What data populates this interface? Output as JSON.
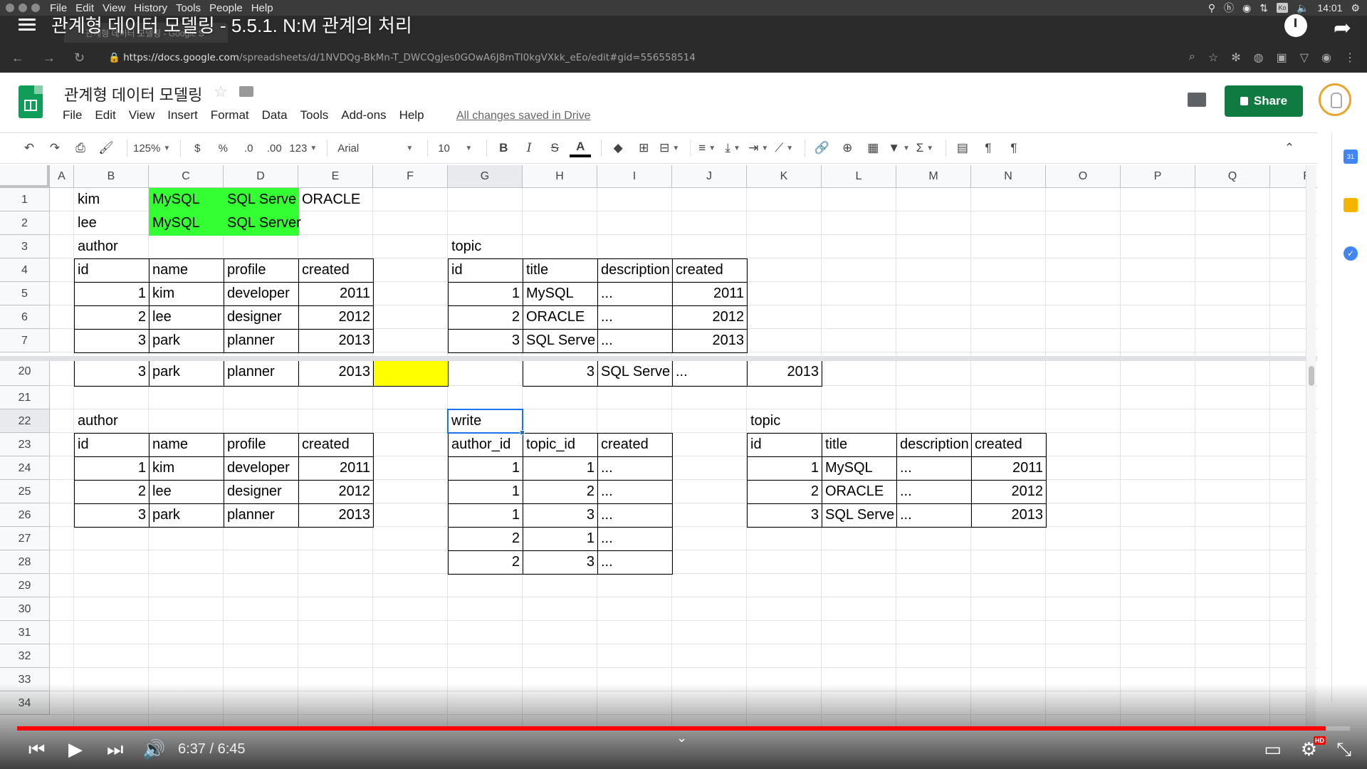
{
  "os_bar": {
    "menu": [
      "File",
      "Edit",
      "View",
      "History",
      "Tools",
      "People",
      "Help"
    ],
    "clock": "14:01",
    "kb": "Ko"
  },
  "video": {
    "title": "관계형 데이터 모델링 - 5.5.1. N:M 관계의 처리",
    "time": "6:37 / 6:45",
    "progress": 0.982,
    "hd": "HD"
  },
  "browser": {
    "tab_title": "관계형 데이터 모델링 - Google S",
    "url_host": "https://docs.google.com",
    "url_path": "/spreadsheets/d/1NVDQg-BkMn-T_DWCQgJes0GOwA6J8mTI0kgVXkk_eEo/edit#gid=556558514"
  },
  "sheets": {
    "title": "관계형 데이터 모델링",
    "menu": [
      "File",
      "Edit",
      "View",
      "Insert",
      "Format",
      "Data",
      "Tools",
      "Add-ons",
      "Help"
    ],
    "saved_status": "All changes saved in Drive",
    "share_label": "Share",
    "toolbar": {
      "zoom": "125%",
      "currency": "$",
      "percent": "%",
      "dec_less": ".0",
      "dec_more": ".00",
      "format": "123",
      "font": "Arial",
      "size": "10"
    }
  },
  "grid": {
    "columns": [
      "A",
      "B",
      "C",
      "D",
      "E",
      "F",
      "G",
      "H",
      "I",
      "J",
      "K",
      "L",
      "M",
      "N",
      "O",
      "P",
      "Q",
      "R"
    ],
    "rows": [
      "1",
      "2",
      "3",
      "4",
      "5",
      "6",
      "7",
      "20",
      "21",
      "22",
      "23",
      "24",
      "25",
      "26",
      "27",
      "28",
      "29",
      "30",
      "31",
      "32",
      "33",
      "34"
    ],
    "cells": [
      {
        "r": 0,
        "c": 1,
        "v": "kim"
      },
      {
        "r": 0,
        "c": 2,
        "v": "MySQL",
        "fill": "#33ff33"
      },
      {
        "r": 0,
        "c": 3,
        "v": "SQL Serve",
        "fill": "#33ff33"
      },
      {
        "r": 0,
        "c": 4,
        "v": "ORACLE"
      },
      {
        "r": 1,
        "c": 1,
        "v": "lee"
      },
      {
        "r": 1,
        "c": 2,
        "v": "MySQL",
        "fill": "#33ff33"
      },
      {
        "r": 1,
        "c": 3,
        "v": "SQL Server",
        "fill": "#33ff33"
      },
      {
        "r": 2,
        "c": 1,
        "v": "author"
      },
      {
        "r": 2,
        "c": 6,
        "v": "topic"
      },
      {
        "r": 3,
        "c": 1,
        "v": "id",
        "b": 1
      },
      {
        "r": 3,
        "c": 2,
        "v": "name",
        "b": 1
      },
      {
        "r": 3,
        "c": 3,
        "v": "profile",
        "b": 1
      },
      {
        "r": 3,
        "c": 4,
        "v": "created",
        "b": 1
      },
      {
        "r": 3,
        "c": 6,
        "v": "id",
        "b": 1
      },
      {
        "r": 3,
        "c": 7,
        "v": "title",
        "b": 1
      },
      {
        "r": 3,
        "c": 8,
        "v": "description",
        "b": 1
      },
      {
        "r": 3,
        "c": 9,
        "v": "created",
        "b": 1
      },
      {
        "r": 4,
        "c": 1,
        "v": "1",
        "b": 1,
        "n": 1
      },
      {
        "r": 4,
        "c": 2,
        "v": "kim",
        "b": 1
      },
      {
        "r": 4,
        "c": 3,
        "v": "developer",
        "b": 1
      },
      {
        "r": 4,
        "c": 4,
        "v": "2011",
        "b": 1,
        "n": 1
      },
      {
        "r": 4,
        "c": 6,
        "v": "1",
        "b": 1,
        "n": 1
      },
      {
        "r": 4,
        "c": 7,
        "v": "MySQL",
        "b": 1
      },
      {
        "r": 4,
        "c": 8,
        "v": "...",
        "b": 1
      },
      {
        "r": 4,
        "c": 9,
        "v": "2011",
        "b": 1,
        "n": 1
      },
      {
        "r": 5,
        "c": 1,
        "v": "2",
        "b": 1,
        "n": 1
      },
      {
        "r": 5,
        "c": 2,
        "v": "lee",
        "b": 1
      },
      {
        "r": 5,
        "c": 3,
        "v": "designer",
        "b": 1
      },
      {
        "r": 5,
        "c": 4,
        "v": "2012",
        "b": 1,
        "n": 1
      },
      {
        "r": 5,
        "c": 6,
        "v": "2",
        "b": 1,
        "n": 1
      },
      {
        "r": 5,
        "c": 7,
        "v": "ORACLE",
        "b": 1
      },
      {
        "r": 5,
        "c": 8,
        "v": "...",
        "b": 1
      },
      {
        "r": 5,
        "c": 9,
        "v": "2012",
        "b": 1,
        "n": 1
      },
      {
        "r": 6,
        "c": 1,
        "v": "3",
        "b": 1,
        "n": 1
      },
      {
        "r": 6,
        "c": 2,
        "v": "park",
        "b": 1
      },
      {
        "r": 6,
        "c": 3,
        "v": "planner",
        "b": 1
      },
      {
        "r": 6,
        "c": 4,
        "v": "2013",
        "b": 1,
        "n": 1
      },
      {
        "r": 6,
        "c": 6,
        "v": "3",
        "b": 1,
        "n": 1
      },
      {
        "r": 6,
        "c": 7,
        "v": "SQL Serve",
        "b": 1
      },
      {
        "r": 6,
        "c": 8,
        "v": "...",
        "b": 1
      },
      {
        "r": 6,
        "c": 9,
        "v": "2013",
        "b": 1,
        "n": 1
      },
      {
        "r": 7,
        "c": 1,
        "v": "3",
        "b": 1,
        "n": 1
      },
      {
        "r": 7,
        "c": 2,
        "v": "park",
        "b": 1
      },
      {
        "r": 7,
        "c": 3,
        "v": "planner",
        "b": 1
      },
      {
        "r": 7,
        "c": 4,
        "v": "2013",
        "b": 1,
        "n": 1
      },
      {
        "r": 7,
        "c": 5,
        "v": "",
        "b": 1,
        "fill": "#ffff00"
      },
      {
        "r": 7,
        "c": 7,
        "v": "3",
        "b": 1,
        "n": 1
      },
      {
        "r": 7,
        "c": 8,
        "v": "SQL Serve",
        "b": 1
      },
      {
        "r": 7,
        "c": 9,
        "v": "...",
        "b": 1
      },
      {
        "r": 7,
        "c": 10,
        "v": "2013",
        "b": 1,
        "n": 1
      },
      {
        "r": 9,
        "c": 1,
        "v": "author"
      },
      {
        "r": 9,
        "c": 6,
        "v": "write"
      },
      {
        "r": 9,
        "c": 10,
        "v": "topic"
      },
      {
        "r": 10,
        "c": 1,
        "v": "id",
        "b": 1
      },
      {
        "r": 10,
        "c": 2,
        "v": "name",
        "b": 1
      },
      {
        "r": 10,
        "c": 3,
        "v": "profile",
        "b": 1
      },
      {
        "r": 10,
        "c": 4,
        "v": "created",
        "b": 1
      },
      {
        "r": 10,
        "c": 6,
        "v": "author_id",
        "b": 1
      },
      {
        "r": 10,
        "c": 7,
        "v": "topic_id",
        "b": 1
      },
      {
        "r": 10,
        "c": 8,
        "v": "created",
        "b": 1
      },
      {
        "r": 10,
        "c": 10,
        "v": "id",
        "b": 1
      },
      {
        "r": 10,
        "c": 11,
        "v": "title",
        "b": 1
      },
      {
        "r": 10,
        "c": 12,
        "v": "description",
        "b": 1
      },
      {
        "r": 10,
        "c": 13,
        "v": "created",
        "b": 1
      },
      {
        "r": 11,
        "c": 1,
        "v": "1",
        "b": 1,
        "n": 1
      },
      {
        "r": 11,
        "c": 2,
        "v": "kim",
        "b": 1
      },
      {
        "r": 11,
        "c": 3,
        "v": "developer",
        "b": 1
      },
      {
        "r": 11,
        "c": 4,
        "v": "2011",
        "b": 1,
        "n": 1
      },
      {
        "r": 11,
        "c": 6,
        "v": "1",
        "b": 1,
        "n": 1
      },
      {
        "r": 11,
        "c": 7,
        "v": "1",
        "b": 1,
        "n": 1
      },
      {
        "r": 11,
        "c": 8,
        "v": "...",
        "b": 1
      },
      {
        "r": 11,
        "c": 10,
        "v": "1",
        "b": 1,
        "n": 1
      },
      {
        "r": 11,
        "c": 11,
        "v": "MySQL",
        "b": 1
      },
      {
        "r": 11,
        "c": 12,
        "v": "...",
        "b": 1
      },
      {
        "r": 11,
        "c": 13,
        "v": "2011",
        "b": 1,
        "n": 1
      },
      {
        "r": 12,
        "c": 1,
        "v": "2",
        "b": 1,
        "n": 1
      },
      {
        "r": 12,
        "c": 2,
        "v": "lee",
        "b": 1
      },
      {
        "r": 12,
        "c": 3,
        "v": "designer",
        "b": 1
      },
      {
        "r": 12,
        "c": 4,
        "v": "2012",
        "b": 1,
        "n": 1
      },
      {
        "r": 12,
        "c": 6,
        "v": "1",
        "b": 1,
        "n": 1
      },
      {
        "r": 12,
        "c": 7,
        "v": "2",
        "b": 1,
        "n": 1
      },
      {
        "r": 12,
        "c": 8,
        "v": "...",
        "b": 1
      },
      {
        "r": 12,
        "c": 10,
        "v": "2",
        "b": 1,
        "n": 1
      },
      {
        "r": 12,
        "c": 11,
        "v": "ORACLE",
        "b": 1
      },
      {
        "r": 12,
        "c": 12,
        "v": "...",
        "b": 1
      },
      {
        "r": 12,
        "c": 13,
        "v": "2012",
        "b": 1,
        "n": 1
      },
      {
        "r": 13,
        "c": 1,
        "v": "3",
        "b": 1,
        "n": 1
      },
      {
        "r": 13,
        "c": 2,
        "v": "park",
        "b": 1
      },
      {
        "r": 13,
        "c": 3,
        "v": "planner",
        "b": 1
      },
      {
        "r": 13,
        "c": 4,
        "v": "2013",
        "b": 1,
        "n": 1
      },
      {
        "r": 13,
        "c": 6,
        "v": "1",
        "b": 1,
        "n": 1
      },
      {
        "r": 13,
        "c": 7,
        "v": "3",
        "b": 1,
        "n": 1
      },
      {
        "r": 13,
        "c": 8,
        "v": "...",
        "b": 1
      },
      {
        "r": 13,
        "c": 10,
        "v": "3",
        "b": 1,
        "n": 1
      },
      {
        "r": 13,
        "c": 11,
        "v": "SQL Serve",
        "b": 1
      },
      {
        "r": 13,
        "c": 12,
        "v": "...",
        "b": 1
      },
      {
        "r": 13,
        "c": 13,
        "v": "2013",
        "b": 1,
        "n": 1
      },
      {
        "r": 14,
        "c": 6,
        "v": "2",
        "b": 1,
        "n": 1
      },
      {
        "r": 14,
        "c": 7,
        "v": "1",
        "b": 1,
        "n": 1
      },
      {
        "r": 14,
        "c": 8,
        "v": "...",
        "b": 1
      },
      {
        "r": 15,
        "c": 6,
        "v": "2",
        "b": 1,
        "n": 1
      },
      {
        "r": 15,
        "c": 7,
        "v": "3",
        "b": 1,
        "n": 1
      },
      {
        "r": 15,
        "c": 8,
        "v": "...",
        "b": 1
      }
    ],
    "active_cell": {
      "r": 9,
      "c": 6
    }
  }
}
